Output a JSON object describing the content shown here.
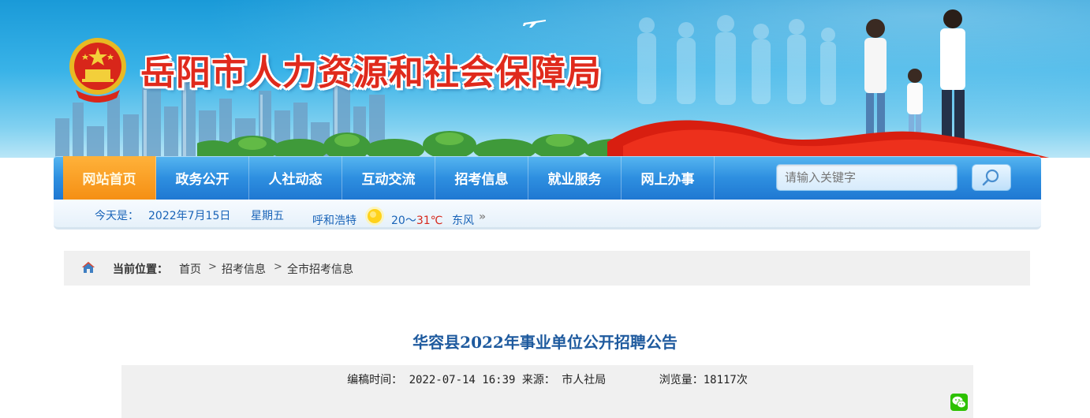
{
  "site": {
    "title": "岳阳市人力资源和社会保障局"
  },
  "nav": {
    "items": [
      {
        "label": "网站首页",
        "active": true
      },
      {
        "label": "政务公开",
        "active": false
      },
      {
        "label": "人社动态",
        "active": false
      },
      {
        "label": "互动交流",
        "active": false
      },
      {
        "label": "招考信息",
        "active": false
      },
      {
        "label": "就业服务",
        "active": false
      },
      {
        "label": "网上办事",
        "active": false
      }
    ],
    "search_placeholder": "请输入关键字",
    "search_icon": "magnifier-icon"
  },
  "infobar": {
    "today_label": "今天是：",
    "date": "2022年7月15日",
    "weekday": "星期五",
    "city": "呼和浩特",
    "weather_icon": "sun-icon",
    "temp_low": "20～",
    "temp_high": "31℃",
    "wind": "东风",
    "more": "»"
  },
  "breadcrumb": {
    "home_icon": "home-icon",
    "label": "当前位置：",
    "items": [
      "首页",
      "招考信息",
      "全市招考信息"
    ],
    "separator": ">"
  },
  "article": {
    "title": "华容县2022年事业单位公开招聘公告",
    "meta_line": "编稿时间： 2022-07-14 16:39 来源： 市人社局        浏览量：18117次",
    "share_icon": "wechat-icon"
  },
  "colors": {
    "nav_blue": "#2e8fe0",
    "nav_active": "#f58f14",
    "title_red": "#e02a1c",
    "article_title": "#1e5a9e",
    "link_blue": "#1a64b8"
  }
}
